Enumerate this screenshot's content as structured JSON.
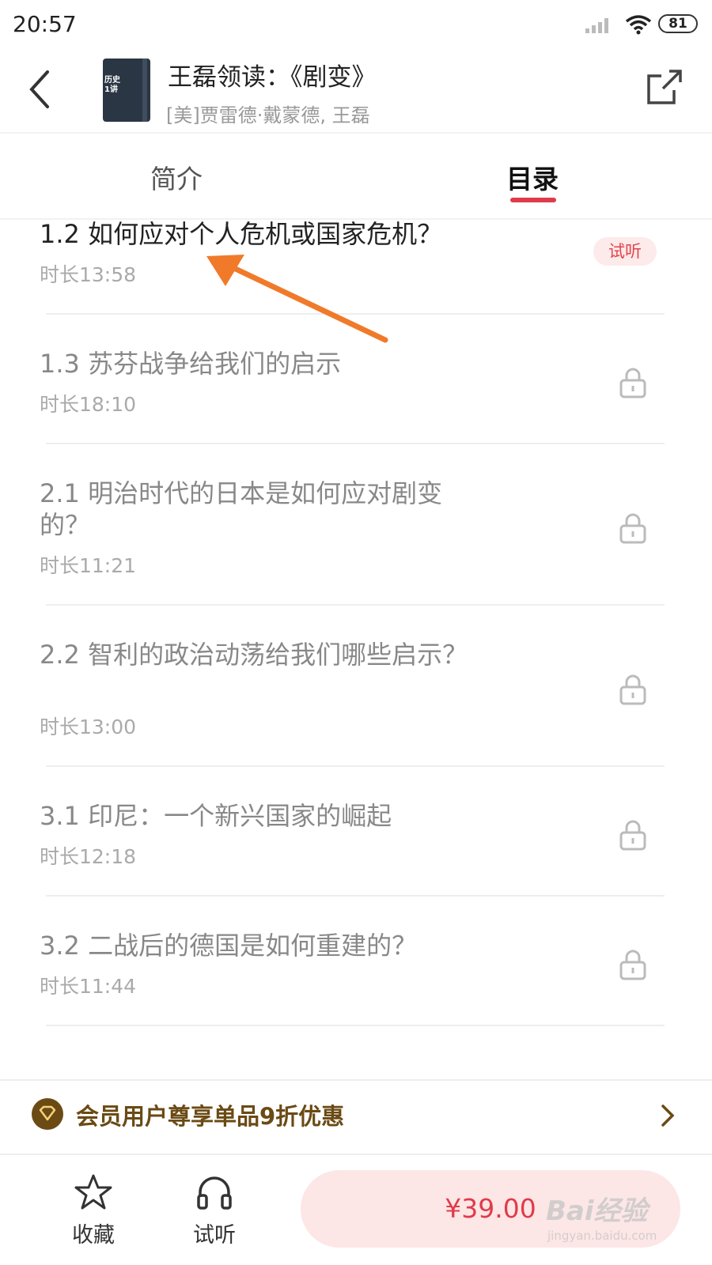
{
  "status_bar": {
    "time": "20:57",
    "battery": "81"
  },
  "header": {
    "cover_text_1": "历史",
    "cover_text_2": "1讲",
    "title": "王磊领读：《剧变》",
    "author": "[美]贾雷德·戴蒙德, 王磊"
  },
  "tabs": [
    {
      "label": "简介"
    },
    {
      "label": "目录"
    }
  ],
  "chapters": [
    {
      "title": "1.2  如何应对个人危机或国家危机？",
      "duration": "时长13:58",
      "badge": "试听"
    },
    {
      "title": "1.3  苏芬战争给我们的启示",
      "duration": "时长18:10"
    },
    {
      "title": "2.1 明治时代的日本是如何应对剧变的？",
      "duration": "时长11:21"
    },
    {
      "title": "2.2 智利的政治动荡给我们哪些启示？",
      "duration": "时长13:00"
    },
    {
      "title": "3.1 印尼：一个新兴国家的崛起",
      "duration": "时长12:18"
    },
    {
      "title": "3.2 二战后的德国是如何重建的？",
      "duration": "时长11:44"
    }
  ],
  "promo": {
    "text": "会员用户尊享单品9折优惠"
  },
  "bottom_bar": {
    "favorite_label": "收藏",
    "listen_label": "试听",
    "price": "¥39.00"
  },
  "watermark": {
    "main": "Bai经验",
    "sub": "jingyan.baidu.com"
  },
  "colors": {
    "accent": "#e03b4a",
    "promo": "#6b4a14",
    "badge_bg": "#fdeaea",
    "annotation_arrow": "#f07a2a"
  },
  "icons": [
    "signal-icon",
    "wifi-icon",
    "back-arrow-icon",
    "share-icon",
    "lock-icon",
    "member-diamond-icon",
    "chevron-right-icon",
    "star-icon",
    "headphones-icon"
  ]
}
